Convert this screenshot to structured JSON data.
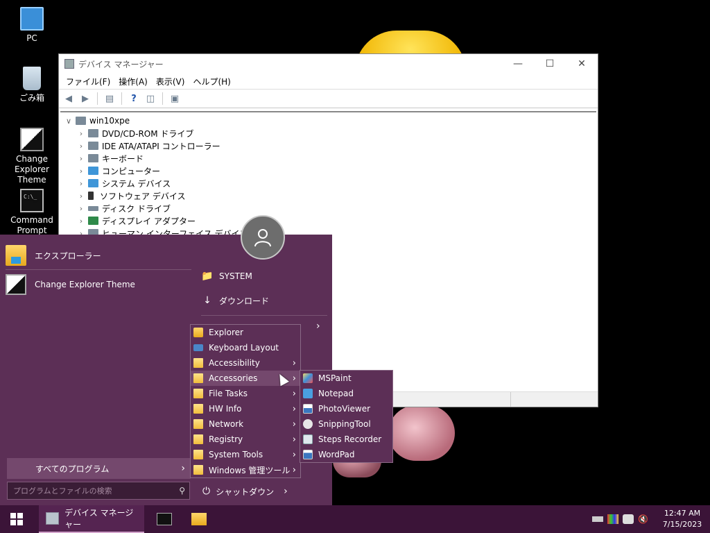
{
  "desktop": {
    "icons": [
      {
        "label": "PC"
      },
      {
        "label": "ごみ箱"
      },
      {
        "label": "Change Explorer Theme"
      },
      {
        "label": "Command Prompt"
      }
    ]
  },
  "window": {
    "title": "デバイス マネージャー",
    "menu": [
      "ファイル(F)",
      "操作(A)",
      "表示(V)",
      "ヘルプ(H)"
    ],
    "tree_root": "win10xpe",
    "tree_items": [
      "DVD/CD-ROM ドライブ",
      "IDE ATA/ATAPI コントローラー",
      "キーボード",
      "コンピューター",
      "システム デバイス",
      "ソフトウェア デバイス",
      "ディスク ドライブ",
      "ディスプレイ アダプター",
      "ヒューマン インターフェイス デバイス"
    ]
  },
  "start_menu": {
    "pinned": [
      "エクスプローラー",
      "Change Explorer Theme"
    ],
    "right": [
      "SYSTEM",
      "ダウンロード"
    ],
    "all_programs": "すべてのプログラム",
    "search_placeholder": "プログラムとファイルの検索",
    "shutdown": "シャットダウン"
  },
  "programs_menu": {
    "items": [
      {
        "label": "Explorer",
        "submenu": false
      },
      {
        "label": "Keyboard Layout",
        "submenu": false
      },
      {
        "label": "Accessibility",
        "submenu": true
      },
      {
        "label": "Accessories",
        "submenu": true
      },
      {
        "label": "File Tasks",
        "submenu": true
      },
      {
        "label": "HW Info",
        "submenu": true
      },
      {
        "label": "Network",
        "submenu": true
      },
      {
        "label": "Registry",
        "submenu": true
      },
      {
        "label": "System Tools",
        "submenu": true
      },
      {
        "label": "Windows 管理ツール",
        "submenu": true
      }
    ],
    "highlighted": "Accessories"
  },
  "accessories_menu": {
    "items": [
      "MSPaint",
      "Notepad",
      "PhotoViewer",
      "SnippingTool",
      "Steps Recorder",
      "WordPad"
    ]
  },
  "taskbar": {
    "active_app": "デバイス マネージャー",
    "time": "12:47 AM",
    "date": "7/15/2023"
  },
  "colors": {
    "start_bg": "#5c2f56",
    "taskbar_bg": "#3b1438",
    "highlight": "#74486d"
  }
}
